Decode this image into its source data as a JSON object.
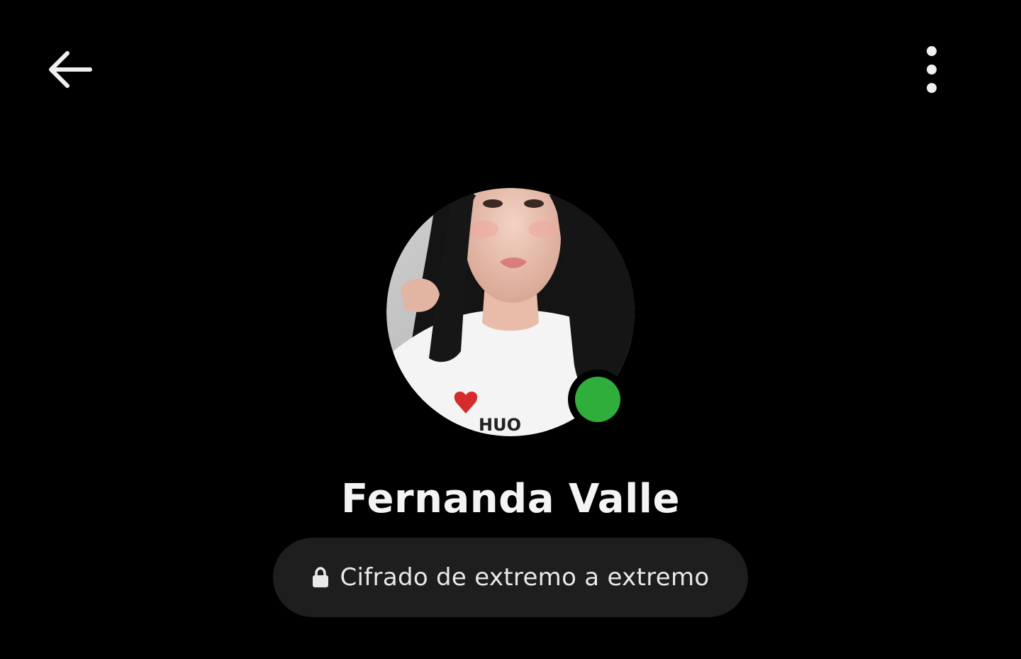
{
  "header": {
    "back_icon": "arrow-left-icon",
    "menu_icon": "more-vertical-icon"
  },
  "profile": {
    "name": "Fernanda Valle",
    "avatar_description": "profile photo",
    "presence": "online",
    "presence_color": "#2fae3c"
  },
  "encryption": {
    "icon": "lock-icon",
    "label": "Cifrado de extremo a extremo"
  },
  "colors": {
    "background": "#000000",
    "pill_background": "#1e1e1f",
    "text": "#f4f4f4"
  }
}
